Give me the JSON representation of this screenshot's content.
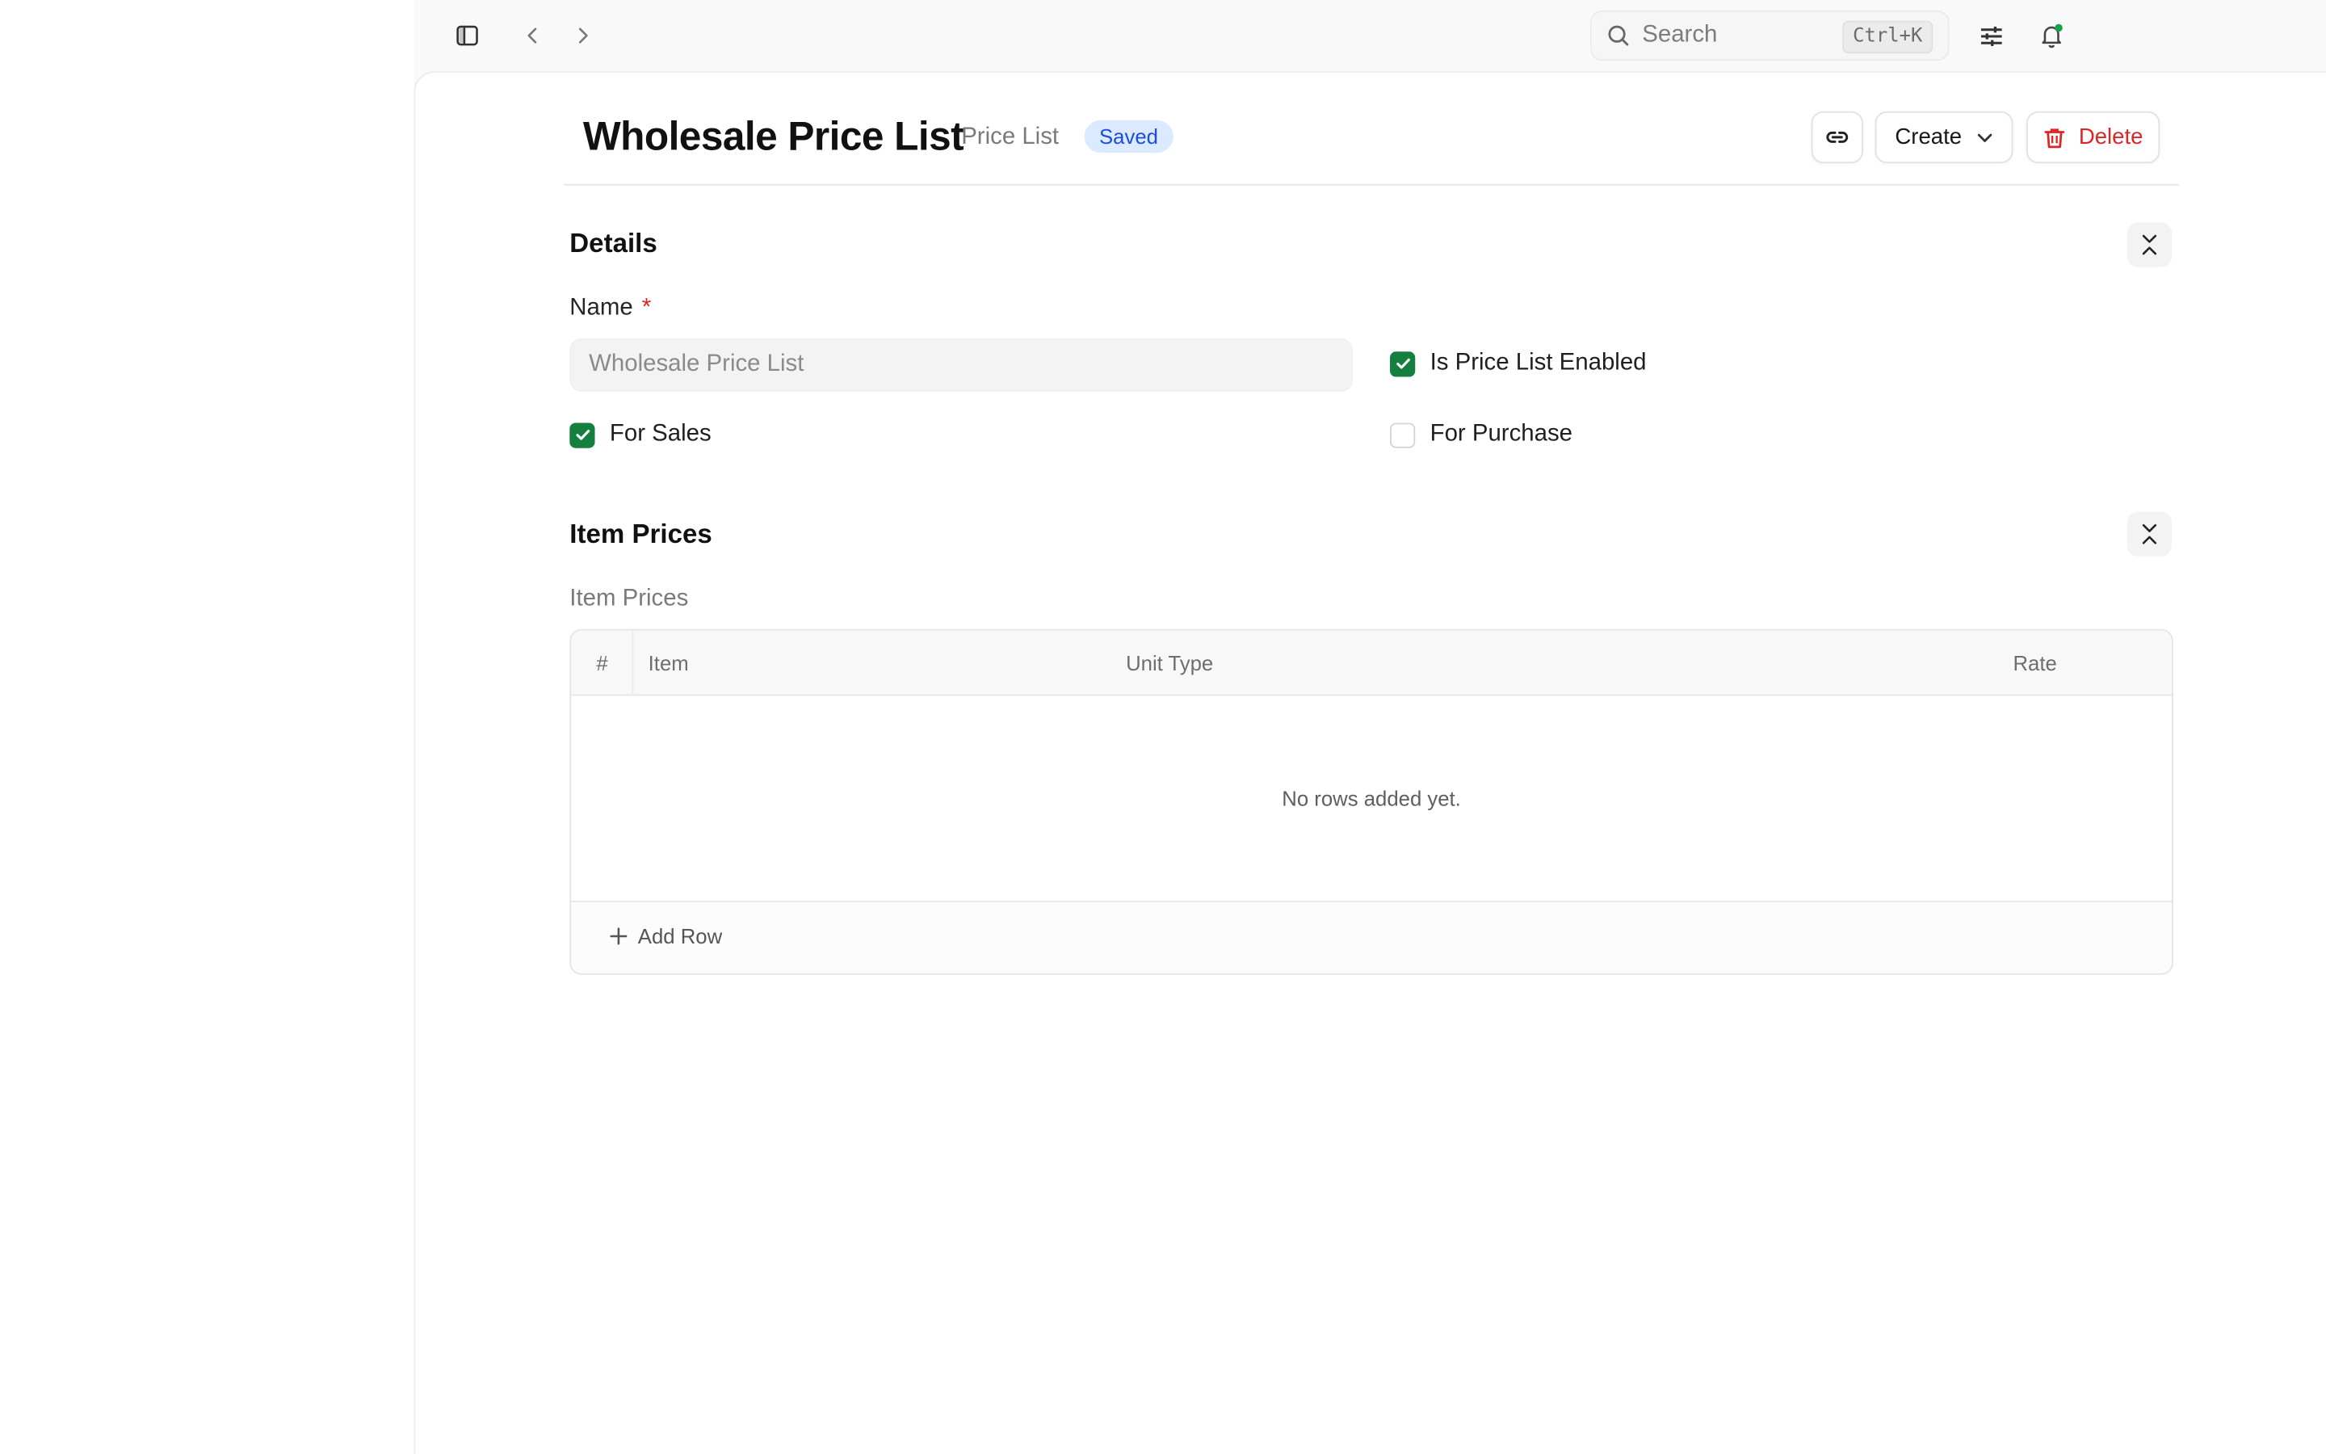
{
  "topbar": {
    "search_placeholder": "Search",
    "search_shortcut": "Ctrl+K"
  },
  "header": {
    "title": "Wholesale Price List",
    "doctype": "Price List",
    "status": "Saved",
    "create_label": "Create",
    "delete_label": "Delete"
  },
  "details": {
    "section_title": "Details",
    "name_label": "Name",
    "name_required_mark": "*",
    "name_value": "Wholesale Price List",
    "is_enabled_label": "Is Price List Enabled",
    "is_enabled": true,
    "for_sales_label": "For Sales",
    "for_sales": true,
    "for_purchase_label": "For Purchase",
    "for_purchase": false
  },
  "item_prices": {
    "section_title": "Item Prices",
    "table_label": "Item Prices",
    "columns": [
      "#",
      "Item",
      "Unit Type",
      "Rate"
    ],
    "rows": [],
    "empty_message": "No rows added yet.",
    "add_row_label": "Add Row"
  },
  "colors": {
    "accent_green": "#15803d",
    "danger_red": "#dc2626",
    "badge_blue": "#1d4ed8"
  }
}
